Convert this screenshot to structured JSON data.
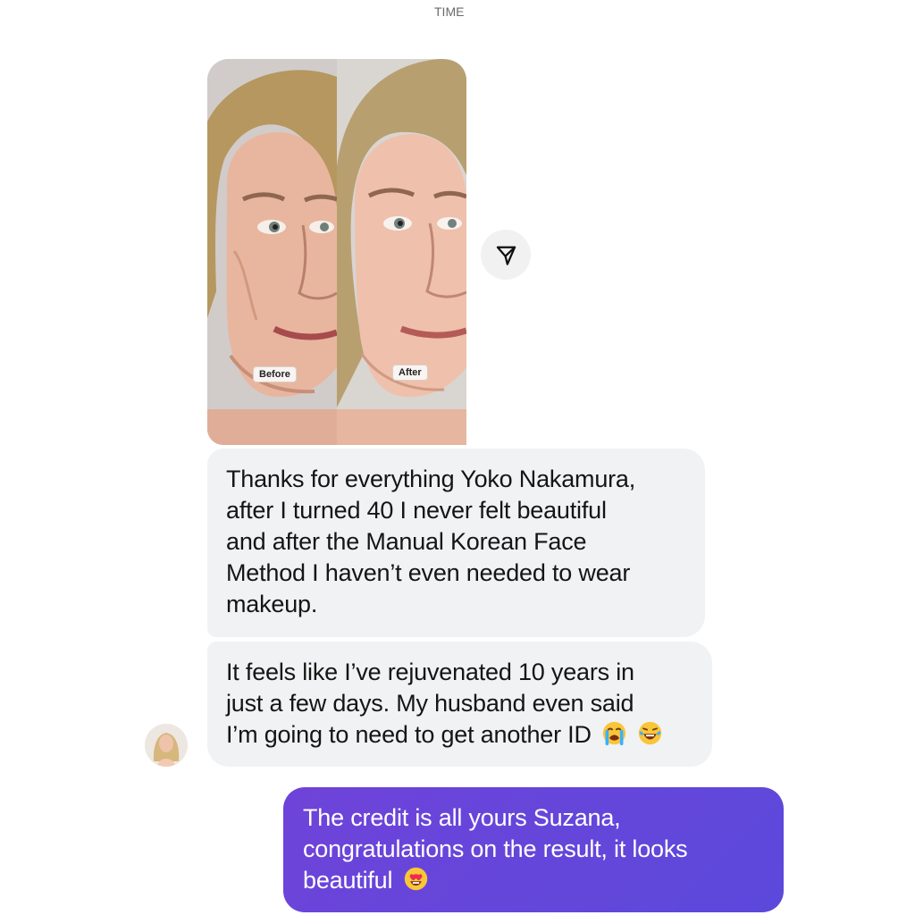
{
  "header": {
    "cut_text": "TIME"
  },
  "photo": {
    "before_label": "Before",
    "after_label": "After"
  },
  "messages": [
    {
      "text_lines": [
        "Thanks for everything Yoko Nakamura,",
        "after I turned 40 I never felt beautiful",
        "and after the Manual Korean Face",
        "Method I haven’t even needed to wear",
        "makeup."
      ]
    },
    {
      "text_lines": [
        "It feels like I’ve rejuvenated 10 years in",
        "just a few days. My husband even said",
        "I’m going to need to get another ID"
      ],
      "emoji_names": [
        "loudly-crying-face-emoji",
        "tears-of-joy-emoji"
      ]
    },
    {
      "text_lines": [
        "The credit is all yours Suzana,",
        "congratulations on the result, it looks",
        "beautiful"
      ],
      "emoji_names": [
        "heart-eyes-emoji"
      ]
    }
  ],
  "icons": {
    "share": "send-icon",
    "avatar": "avatar"
  },
  "colors": {
    "incoming_bubble": "#f1f2f3",
    "outgoing_bubble": "#6548db",
    "outgoing_text": "#ffffff",
    "incoming_text": "#151515"
  }
}
